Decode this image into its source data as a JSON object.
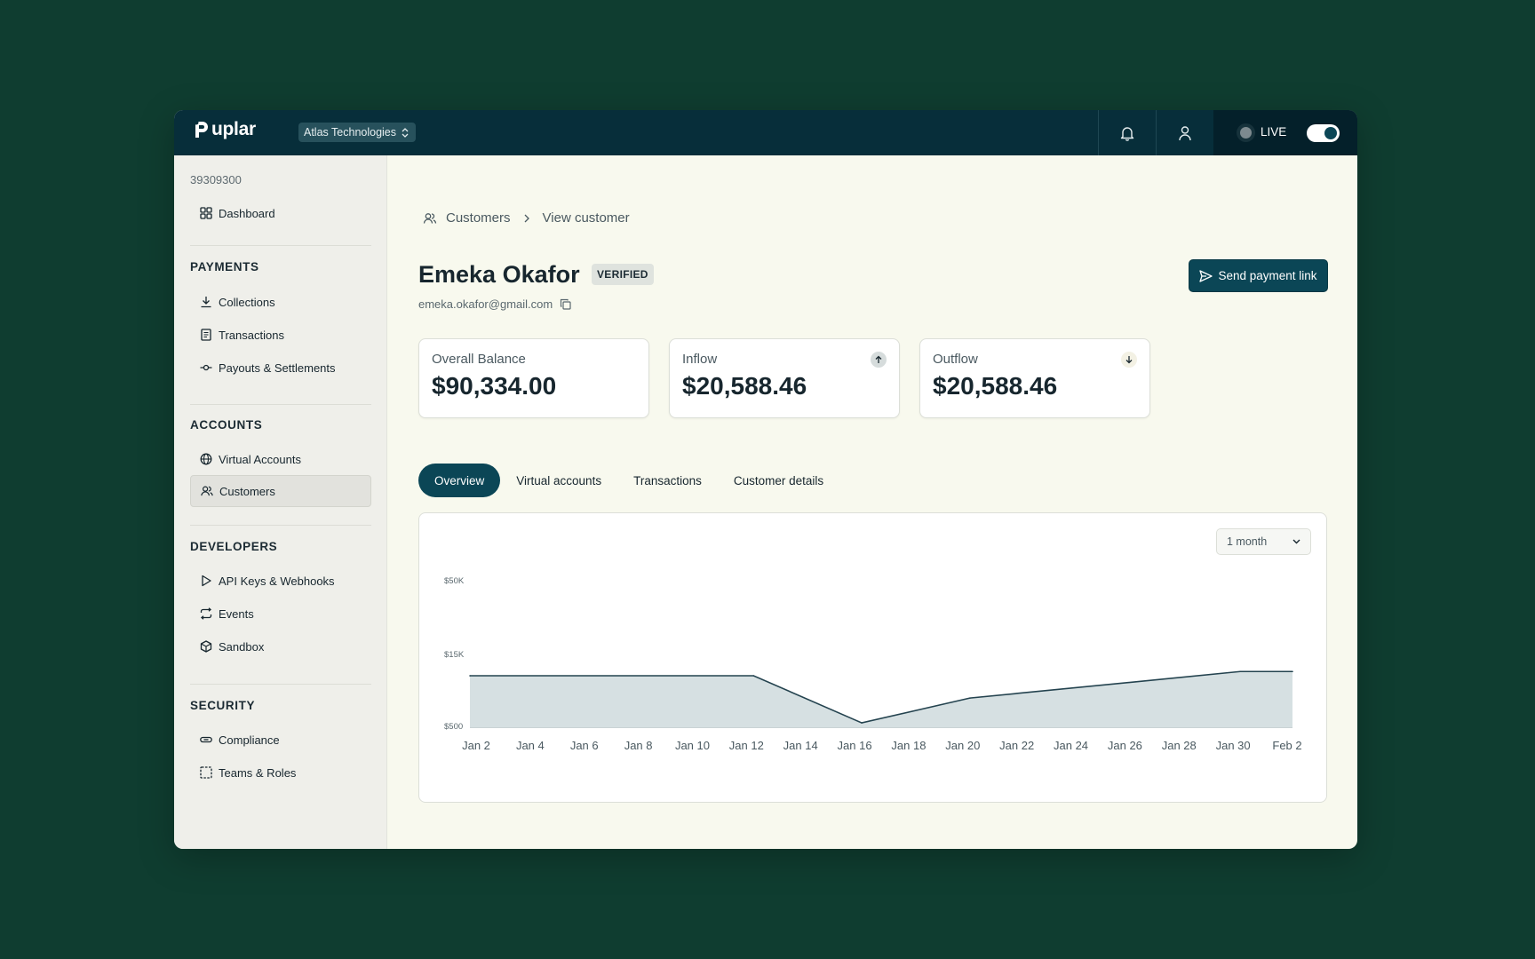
{
  "app": {
    "logo_text": "uplar",
    "logo_mark": "P",
    "organization": "Atlas Technologies",
    "mode_label": "LIVE"
  },
  "sidebar": {
    "account_id": "39309300",
    "dashboard_label": "Dashboard",
    "sections": {
      "payments": {
        "title": "PAYMENTS",
        "items": [
          "Collections",
          "Transactions",
          "Payouts & Settlements"
        ]
      },
      "accounts": {
        "title": "ACCOUNTS",
        "items": [
          "Virtual Accounts",
          "Customers"
        ]
      },
      "developers": {
        "title": "DEVELOPERS",
        "items": [
          "API Keys & Webhooks",
          "Events",
          "Sandbox"
        ]
      },
      "security": {
        "title": "SECURITY",
        "items": [
          "Compliance",
          "Teams & Roles"
        ]
      }
    },
    "active_item": "Customers"
  },
  "breadcrumb": {
    "parent": "Customers",
    "current": "View customer"
  },
  "customer": {
    "name": "Emeka Okafor",
    "status_badge": "VERIFIED",
    "email": "emeka.okafor@gmail.com"
  },
  "actions": {
    "send_payment_link": "Send payment link"
  },
  "stats": {
    "balance": {
      "label": "Overall Balance",
      "value": "$90,334.00"
    },
    "inflow": {
      "label": "Inflow",
      "value": "$20,588.46"
    },
    "outflow": {
      "label": "Outflow",
      "value": "$20,588.46"
    }
  },
  "tabs": [
    "Overview",
    "Virtual accounts",
    "Transactions",
    "Customer details"
  ],
  "active_tab": "Overview",
  "range_select": {
    "value": "1 month"
  },
  "colors": {
    "background": "#0f3d30",
    "topbar": "#072e3a",
    "accent": "#0b4656",
    "area_fill": "#d6e0e2",
    "line": "#24434f"
  },
  "chart_data": {
    "type": "area",
    "x": [
      "Jan 2",
      "Jan 4",
      "Jan 6",
      "Jan 8",
      "Jan 10",
      "Jan 12",
      "Jan 14",
      "Jan 16",
      "Jan 18",
      "Jan 20",
      "Jan 22",
      "Jan 24",
      "Jan 26",
      "Jan 28",
      "Jan 30",
      "Feb 2"
    ],
    "y_ticks": [
      "$500",
      "$15K",
      "$50K"
    ],
    "series": [
      {
        "points": [
          [
            "Jan 2",
            15000
          ],
          [
            "Jan 12",
            15000
          ],
          [
            "Jan 16",
            5500
          ],
          [
            "Jan 20",
            10500
          ],
          [
            "Jan 30",
            17000
          ],
          [
            "Feb 2",
            17000
          ]
        ]
      }
    ],
    "title": "",
    "xlabel": "",
    "ylabel": "",
    "grid": false
  }
}
